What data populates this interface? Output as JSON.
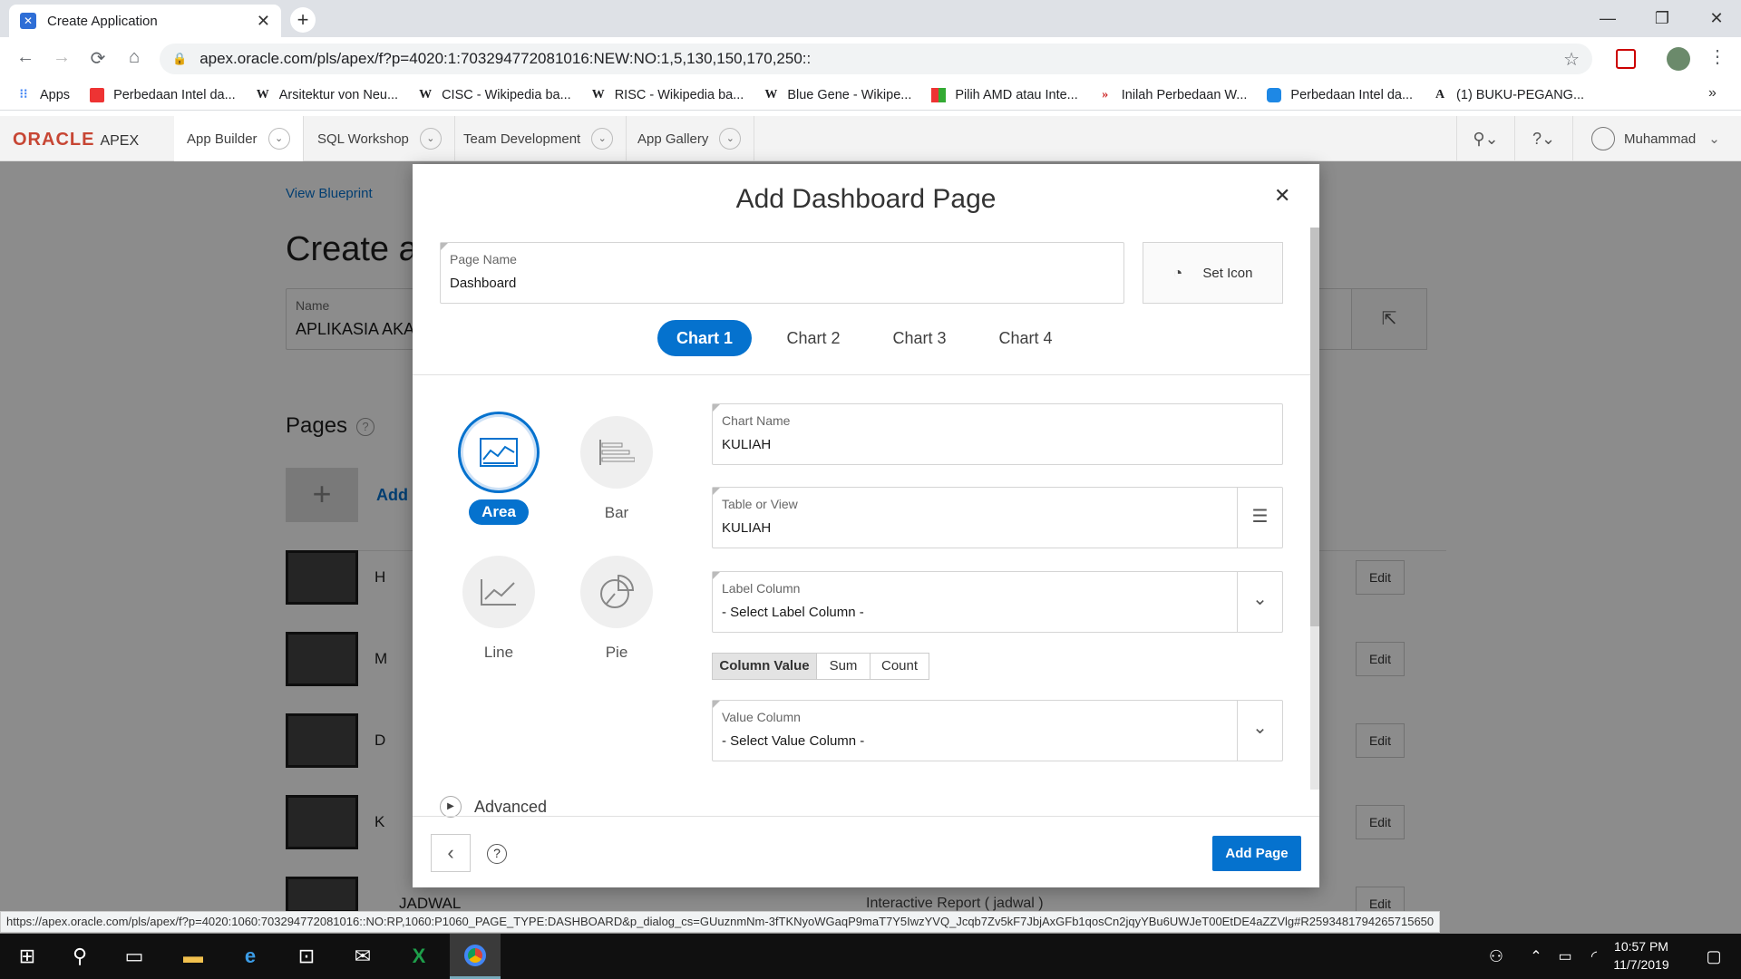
{
  "browser": {
    "tab_title": "Create Application",
    "url": "apex.oracle.com/pls/apex/f?p=4020:1:703294772081016:NEW:NO:1,5,130,150,170,250::",
    "bookmarks": [
      {
        "label": "Apps",
        "icon": "apps-grid-icon"
      },
      {
        "label": "Perbedaan Intel da...",
        "icon": "bookmark-icon"
      },
      {
        "label": "Arsitektur von Neu...",
        "icon": "wikipedia-icon"
      },
      {
        "label": "CISC - Wikipedia ba...",
        "icon": "wikipedia-icon"
      },
      {
        "label": "RISC - Wikipedia ba...",
        "icon": "wikipedia-icon"
      },
      {
        "label": "Blue Gene - Wikipe...",
        "icon": "wikipedia-icon"
      },
      {
        "label": "Pilih AMD atau Inte...",
        "icon": "bookmark-icon"
      },
      {
        "label": "Inilah Perbedaan W...",
        "icon": "bookmark-icon"
      },
      {
        "label": "Perbedaan Intel da...",
        "icon": "bookmark-icon"
      },
      {
        "label": "(1) BUKU-PEGANG...",
        "icon": "bookmark-icon"
      }
    ],
    "status_url": "https://apex.oracle.com/pls/apex/f?p=4020:1060:703294772081016::NO:RP,1060:P1060_PAGE_TYPE:DASHBOARD&p_dialog_cs=GUuznmNm-3fTKNyoWGaqP9maT7Y5IwzYVQ_Jcqb7Zv5kF7JbjAxGFb1qosCn2jqyYBu6UWJeT00EtDE4aZZVlg#R2593481794265715650"
  },
  "apex_nav": {
    "logo": "ORACLE",
    "logo_suffix": "APEX",
    "tabs": [
      "App Builder",
      "SQL Workshop",
      "Team Development",
      "App Gallery"
    ],
    "user": "Muhammad"
  },
  "background": {
    "view_blueprint": "View Blueprint",
    "create_title": "Create a",
    "name_label": "Name",
    "name_value": "APLIKASIA AKA",
    "pages_title": "Pages",
    "add_label": "Add",
    "rows": [
      {
        "label": "H"
      },
      {
        "label": "M"
      },
      {
        "label": "D"
      },
      {
        "label": "K"
      },
      {
        "label": "JADWAL",
        "type": "Interactive Report ( jadwal )"
      }
    ],
    "edit_label": "Edit"
  },
  "modal": {
    "title": "Add Dashboard Page",
    "page_name_label": "Page Name",
    "page_name_value": "Dashboard",
    "set_icon_label": "Set Icon",
    "chart_tabs": [
      "Chart 1",
      "Chart 2",
      "Chart 3",
      "Chart 4"
    ],
    "chart_types": [
      "Area",
      "Bar",
      "Line",
      "Pie"
    ],
    "chart_name_label": "Chart Name",
    "chart_name_value": "KULIAH",
    "table_label": "Table or View",
    "table_value": "KULIAH",
    "label_column_label": "Label Column",
    "label_column_value": "- Select Label Column -",
    "aggregation": [
      "Column Value",
      "Sum",
      "Count"
    ],
    "value_column_label": "Value Column",
    "value_column_value": "- Select Value Column -",
    "advanced_label": "Advanced",
    "add_page_button": "Add Page"
  },
  "taskbar": {
    "time": "10:57 PM",
    "date": "11/7/2019"
  },
  "colors": {
    "accent": "#0572ce",
    "oracle_red": "#c74634"
  }
}
